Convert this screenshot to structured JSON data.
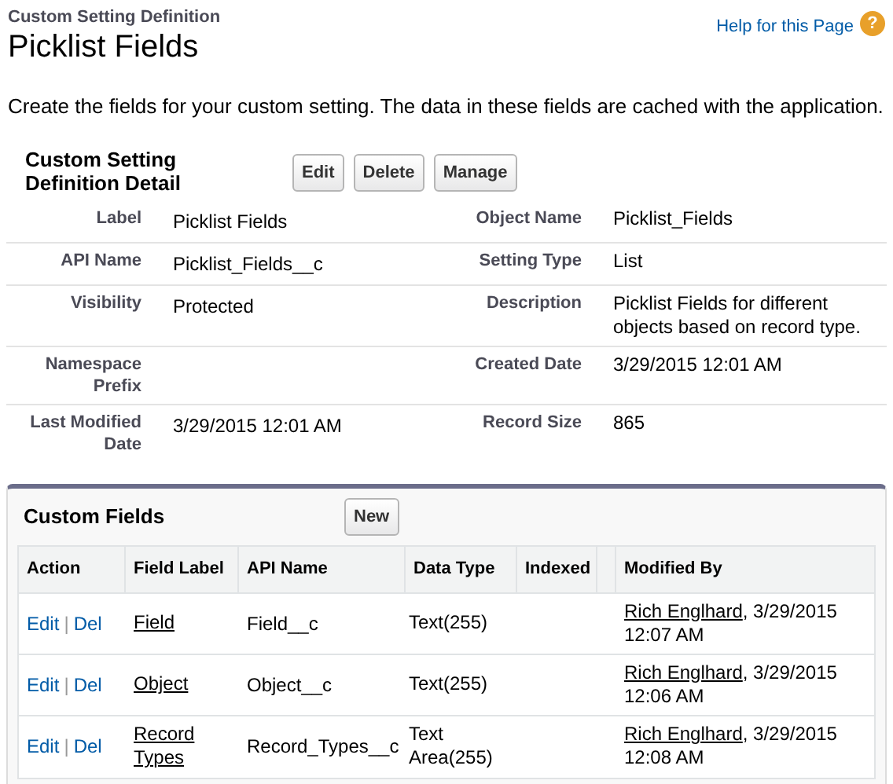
{
  "header": {
    "breadcrumb": "Custom Setting Definition",
    "title": "Picklist Fields",
    "help_link": "Help for this Page",
    "help_icon": "?"
  },
  "intro": "Create the fields for your custom setting. The data in these fields are cached with the application.",
  "detail": {
    "title": "Custom Setting Definition Detail",
    "buttons": [
      "Edit",
      "Delete",
      "Manage"
    ],
    "rows": [
      {
        "left_label": "Label",
        "left_value": "Picklist Fields",
        "right_label": "Object Name",
        "right_value": "Picklist_Fields"
      },
      {
        "left_label": "API Name",
        "left_value": "Picklist_Fields__c",
        "right_label": "Setting Type",
        "right_value": "List"
      },
      {
        "left_label": "Visibility",
        "left_value": "Protected",
        "right_label": "Description",
        "right_value": "Picklist Fields for different objects based on record type."
      },
      {
        "left_label": "Namespace Prefix",
        "right_label": "Created Date",
        "right_value": "3/29/2015 12:01 AM"
      },
      {
        "left_label": "Last Modified Date",
        "left_value": "3/29/2015 12:01 AM",
        "right_label": "Record Size",
        "right_value": "865"
      }
    ]
  },
  "custom_fields": {
    "title": "Custom Fields",
    "button": "New",
    "columns": [
      "Action",
      "Field Label",
      "API Name",
      "Data Type",
      "Indexed",
      "Modified By"
    ],
    "rows": [
      {
        "edit": "Edit",
        "separator": "|",
        "delete": "Del",
        "field_label": "Field",
        "api_name": "Field__c",
        "data_type": "Text(255)",
        "modified_by": "Rich Englhard",
        "modified_date": ", 3/29/2015 12:07 AM"
      },
      {
        "edit": "Edit",
        "separator": "|",
        "delete": "Del",
        "field_label": "Object",
        "api_name": "Object__c",
        "data_type": "Text(255)",
        "modified_by": "Rich Englhard",
        "modified_date": ", 3/29/2015 12:06 AM"
      },
      {
        "edit": "Edit",
        "separator": "|",
        "delete": "Del",
        "field_label": "Record Types",
        "api_name": "Record_Types__c",
        "data_type": "Text Area(255)",
        "modified_by": "Rich Englhard",
        "modified_date": ", 3/29/2015 12:08 AM"
      }
    ]
  }
}
